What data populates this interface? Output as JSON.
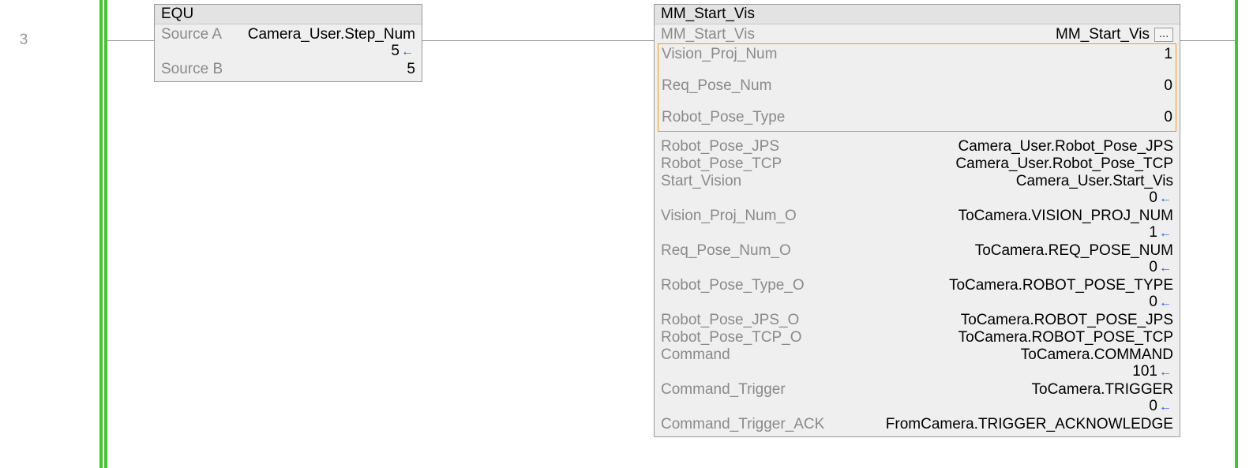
{
  "rung": {
    "number": "3"
  },
  "equ": {
    "title": "EQU",
    "rows": [
      {
        "label": "Source A",
        "value": "Camera_User.Step_Num",
        "live": "5"
      },
      {
        "label": "Source B",
        "value": "5"
      }
    ]
  },
  "mm": {
    "title": "MM_Start_Vis",
    "instance": {
      "label": "MM_Start_Vis",
      "value": "MM_Start_Vis",
      "btn": "..."
    },
    "highlight": [
      {
        "label": "Vision_Proj_Num",
        "value": "1"
      },
      {
        "label": "Req_Pose_Num",
        "value": "0"
      },
      {
        "label": "Robot_Pose_Type",
        "value": "0"
      }
    ],
    "rows": [
      {
        "label": "Robot_Pose_JPS",
        "value": "Camera_User.Robot_Pose_JPS"
      },
      {
        "label": "Robot_Pose_TCP",
        "value": "Camera_User.Robot_Pose_TCP"
      },
      {
        "label": "Start_Vision",
        "value": "Camera_User.Start_Vis",
        "live": "0"
      },
      {
        "label": "Vision_Proj_Num_O",
        "value": "ToCamera.VISION_PROJ_NUM",
        "live": "1"
      },
      {
        "label": "Req_Pose_Num_O",
        "value": "ToCamera.REQ_POSE_NUM",
        "live": "0"
      },
      {
        "label": "Robot_Pose_Type_O",
        "value": "ToCamera.ROBOT_POSE_TYPE",
        "live": "0"
      },
      {
        "label": "Robot_Pose_JPS_O",
        "value": "ToCamera.ROBOT_POSE_JPS"
      },
      {
        "label": "Robot_Pose_TCP_O",
        "value": "ToCamera.ROBOT_POSE_TCP"
      },
      {
        "label": "Command",
        "value": "ToCamera.COMMAND",
        "live": "101"
      },
      {
        "label": "Command_Trigger",
        "value": "ToCamera.TRIGGER",
        "live": "0"
      },
      {
        "label": "Command_Trigger_ACK",
        "value": "FromCamera.TRIGGER_ACKNOWLEDGE"
      }
    ]
  }
}
